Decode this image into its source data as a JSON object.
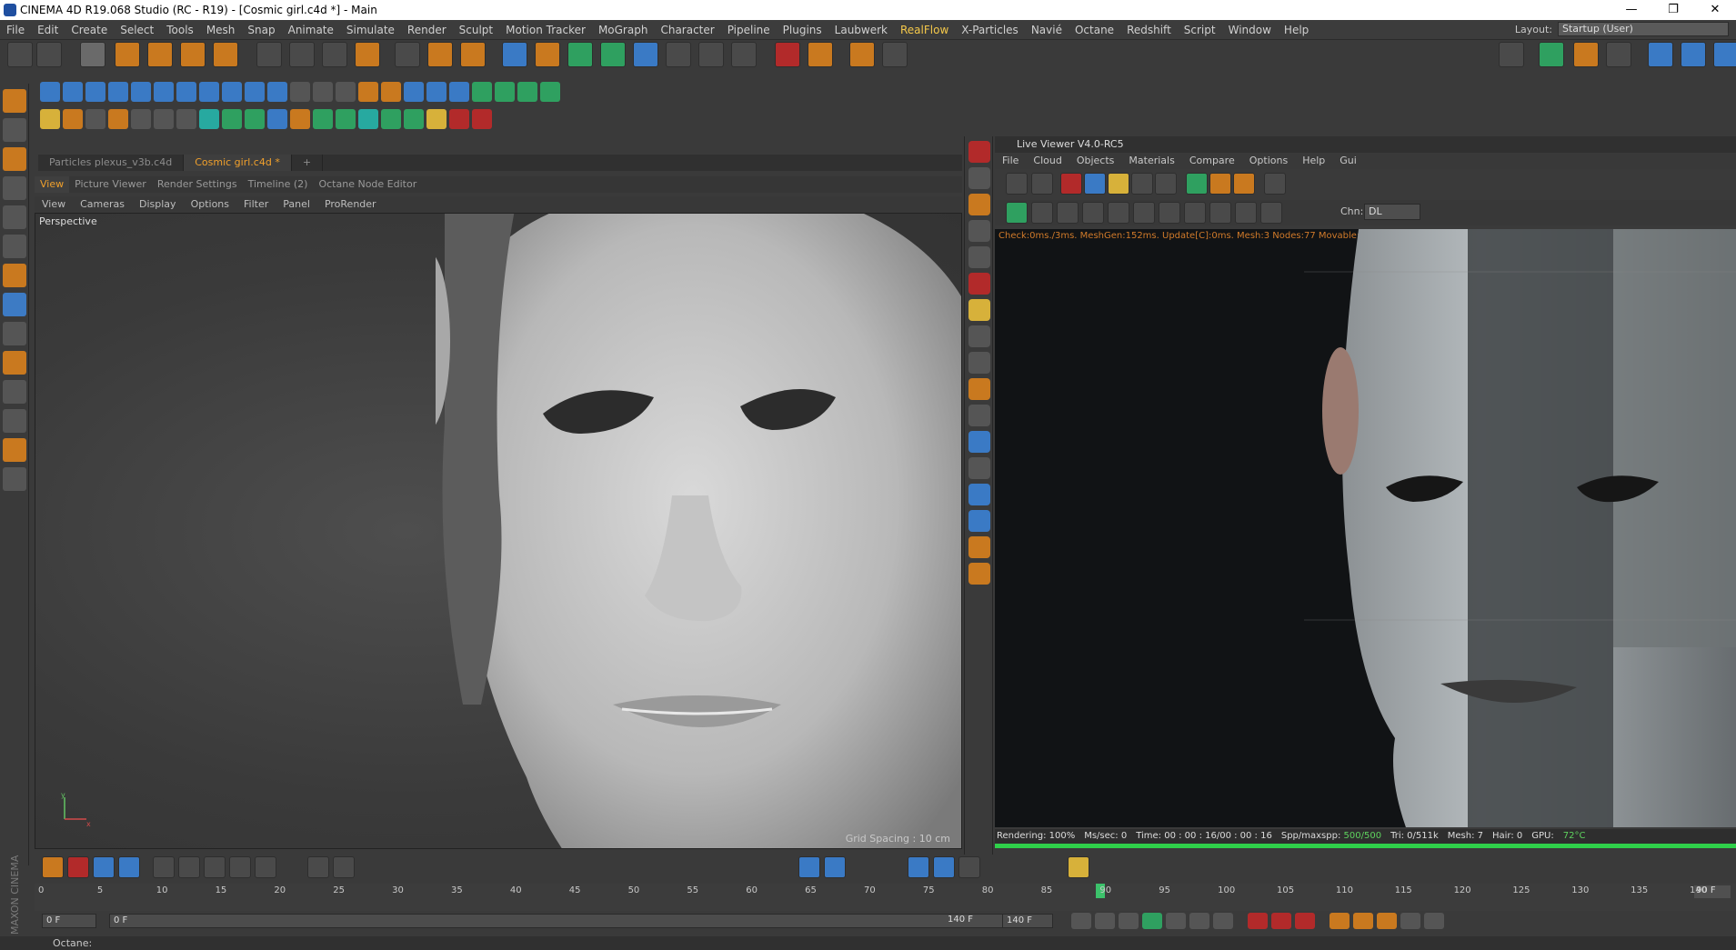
{
  "window": {
    "title": "CINEMA 4D R19.068 Studio (RC - R19) - [Cosmic girl.c4d *] - Main",
    "controls": [
      "—",
      "❐",
      "✕"
    ]
  },
  "menubar": {
    "items": [
      "File",
      "Edit",
      "Create",
      "Select",
      "Tools",
      "Mesh",
      "Snap",
      "Animate",
      "Simulate",
      "Render",
      "Sculpt",
      "Motion Tracker",
      "MoGraph",
      "Character",
      "Pipeline",
      "Plugins",
      "Laubwerk",
      "RealFlow",
      "X-Particles",
      "Navié",
      "Octane",
      "Redshift",
      "Script",
      "Window",
      "Help"
    ],
    "layout_label": "Layout:",
    "layout_value": "Startup (User)"
  },
  "doc_tabs": [
    {
      "label": "Particles plexus_v3b.c4d",
      "active": false
    },
    {
      "label": "Cosmic girl.c4d *",
      "active": true
    }
  ],
  "panel_tabs": [
    "View",
    "Picture Viewer",
    "Render Settings",
    "Timeline (2)",
    "Octane Node Editor"
  ],
  "viewport_menu": [
    "View",
    "Cameras",
    "Display",
    "Options",
    "Filter",
    "Panel",
    "ProRender"
  ],
  "viewport": {
    "label": "Perspective",
    "grid_spacing": "Grid Spacing : 10 cm"
  },
  "live_viewer": {
    "title": "Live Viewer V4.0-RC5",
    "menu": [
      "File",
      "Cloud",
      "Objects",
      "Materials",
      "Compare",
      "Options",
      "Help",
      "Gui"
    ],
    "chn_label": "Chn:",
    "chn_value": "DL",
    "check_line": "Check:0ms./3ms. MeshGen:152ms. Update[C]:0ms. Mesh:3 Nodes:77 Movable:1 0 0",
    "status": {
      "rendering": "Rendering: 100%",
      "mssec": "Ms/sec: 0",
      "time": "Time: 00 : 00 : 16/00 : 00 : 16",
      "spp_label": "Spp/maxspp:",
      "spp_value": "500/500",
      "tri": "Tri: 0/511k",
      "mesh": "Mesh: 7",
      "hair": "Hair: 0",
      "gpu": "GPU:",
      "temp": "72°C"
    },
    "progress": 1.0
  },
  "timeline": {
    "ticks": [
      "0",
      "5",
      "10",
      "15",
      "20",
      "25",
      "30",
      "35",
      "40",
      "45",
      "50",
      "55",
      "60",
      "65",
      "70",
      "75",
      "80",
      "85",
      "90",
      "95",
      "100",
      "105",
      "110",
      "115",
      "120",
      "125",
      "130",
      "135",
      "140"
    ],
    "current_frame": "90",
    "end_field": "90 F"
  },
  "transport": {
    "start": "0 F",
    "min": "0 F",
    "max": "140 F",
    "end": "140 F"
  },
  "statusbar": {
    "text": "Octane:"
  },
  "colors": {
    "accent": "#f0a02c",
    "bg": "#3a3a3a",
    "progress": "#2fd04a"
  }
}
